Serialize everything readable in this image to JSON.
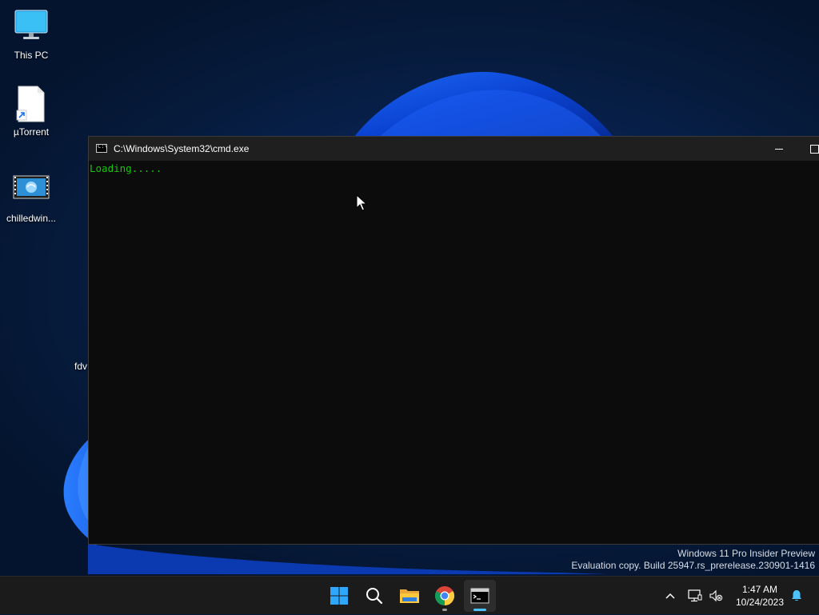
{
  "desktop": {
    "icons": [
      {
        "label": "This PC"
      },
      {
        "label": "µTorrent"
      },
      {
        "label": "chilledwin..."
      },
      {
        "label": "fdv"
      }
    ],
    "watermark": {
      "line1": "Windows 11 Pro Insider Preview",
      "line2": "Evaluation copy. Build 25947.rs_prerelease.230901-1416"
    }
  },
  "cmd_window": {
    "title": "C:\\Windows\\System32\\cmd.exe",
    "console_text": "Loading.....",
    "console_color": "#16c60c"
  },
  "taskbar": {
    "apps": [
      {
        "name": "Start"
      },
      {
        "name": "Search"
      },
      {
        "name": "File Explorer"
      },
      {
        "name": "Google Chrome"
      },
      {
        "name": "Command Prompt"
      }
    ],
    "clock": {
      "time": "1:47 AM",
      "date": "10/24/2023"
    }
  }
}
